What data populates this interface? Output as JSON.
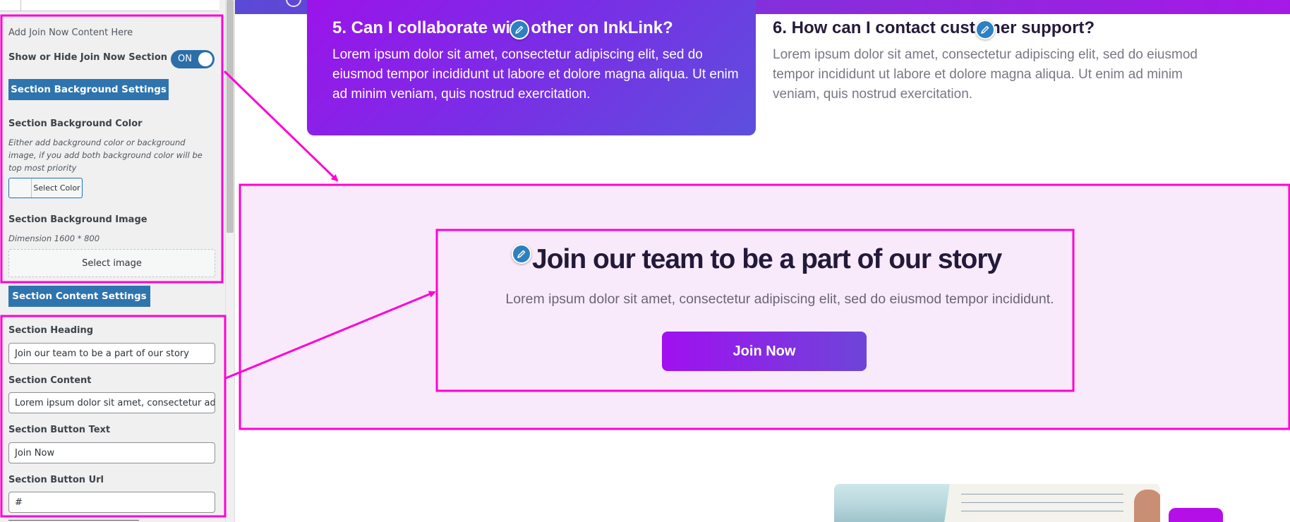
{
  "sidebar": {
    "section_title": "Add Join Now Content Here",
    "show_hide_label": "Show or Hide Join Now Section",
    "toggle_state": "ON",
    "bg_settings_button": "Section Background Settings",
    "bg_color_label": "Section Background Color",
    "bg_color_description": "Either add background color or background image, if you add both background color will be top most priority",
    "select_color_button": "Select Color",
    "bg_image_label": "Section Background Image",
    "bg_image_dimension": "Dimension 1600 * 800",
    "select_image_button": "Select image",
    "content_settings_button": "Section Content Settings",
    "heading_label": "Section Heading",
    "heading_value": "Join our team to be a part of our story",
    "content_label": "Section Content",
    "content_value": "Lorem ipsum dolor sit amet, consectetur adipiscing elit, sed do eiusmod tempor incididunt.",
    "button_text_label": "Section Button Text",
    "button_text_value": "Join Now",
    "button_url_label": "Section Button Url",
    "button_url_value": "#"
  },
  "preview": {
    "faq": [
      {
        "question": "5. Can I collaborate with other on InkLink?",
        "answer": "Lorem ipsum dolor sit amet, consectetur adipiscing elit, sed do eiusmod tempor incididunt ut labore et dolore magna aliqua. Ut enim ad minim veniam, quis nostrud exercitation."
      },
      {
        "question": "6. How can I contact customer support?",
        "answer": "Lorem ipsum dolor sit amet, consectetur adipiscing elit, sed do eiusmod tempor incididunt ut labore et dolore magna aliqua. Ut enim ad minim veniam, quis nostrud exercitation."
      }
    ],
    "join": {
      "heading": "Join our team to be a part of our story",
      "text": "Lorem ipsum dolor sit amet, consectetur adipiscing elit, sed do eiusmod tempor incididunt.",
      "button": "Join Now"
    }
  },
  "colors": {
    "annotation": "#ff00d4",
    "wp_blue": "#2e74ae",
    "join_bg": "#f8eafb",
    "heading": "#231a3a"
  }
}
